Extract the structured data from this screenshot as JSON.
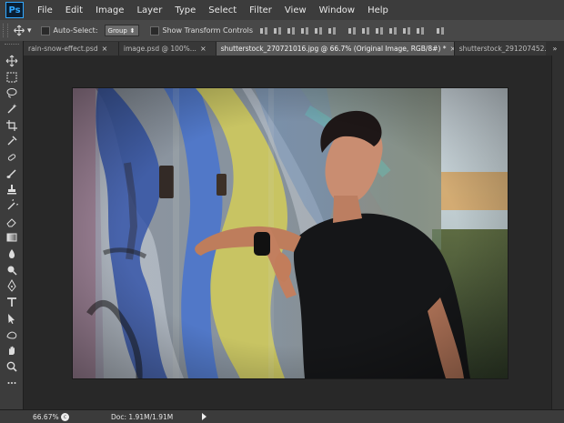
{
  "app": {
    "logo": "Ps"
  },
  "menu": [
    "File",
    "Edit",
    "Image",
    "Layer",
    "Type",
    "Select",
    "Filter",
    "View",
    "Window",
    "Help"
  ],
  "options": {
    "move_tool_icon": "move-icon",
    "auto_select_label": "Auto-Select:",
    "auto_select_value": "Group",
    "show_transform_label": "Show Transform Controls"
  },
  "tabs": [
    {
      "label": "rain-snow-effect.psd",
      "active": false
    },
    {
      "label": "image.psd @ 100%...",
      "active": false
    },
    {
      "label": "shutterstock_270721016.jpg @ 66.7% (Original Image, RGB/8#) *",
      "active": true
    },
    {
      "label": "shutterstock_291207452.j",
      "active": false
    }
  ],
  "tab_overflow": "»",
  "tools": [
    "move-tool-icon",
    "marquee-tool-icon",
    "lasso-tool-icon",
    "magic-wand-tool-icon",
    "crop-tool-icon",
    "eyedropper-tool-icon",
    "healing-brush-tool-icon",
    "brush-tool-icon",
    "clone-stamp-tool-icon",
    "history-brush-tool-icon",
    "eraser-tool-icon",
    "gradient-tool-icon",
    "blur-tool-icon",
    "dodge-tool-icon",
    "pen-tool-icon",
    "type-tool-icon",
    "path-selection-tool-icon",
    "shape-tool-icon",
    "hand-tool-icon",
    "zoom-tool-icon",
    "more-tools-icon"
  ],
  "status": {
    "zoom": "66.67%",
    "doc": "Doc: 1.91M/1.91M"
  },
  "colors": {
    "accent": "#31a8ff",
    "canvas_bg": "#282828",
    "panel_bg": "#3c3c3c"
  }
}
